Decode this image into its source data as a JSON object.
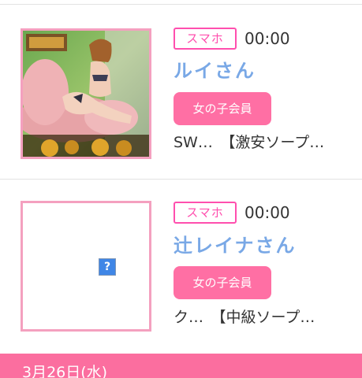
{
  "entries": [
    {
      "device": "スマホ",
      "time": "00:00",
      "name": "ルイさん",
      "badge": "女の子会員",
      "shop": "SW…　【激安ソープ…"
    },
    {
      "device": "スマホ",
      "time": "00:00",
      "name": "辻レイナさん",
      "badge": "女の子会員",
      "shop": "ク…　【中級ソープ…",
      "image_placeholder": "?"
    }
  ],
  "date_header": "3月26日(水)",
  "colors": {
    "pink_border": "#f4a0bf",
    "magenta": "#ff4fae",
    "badge_pink": "#ff6fa4",
    "name_blue": "#79a8e6",
    "date_bar": "#fb6e9f"
  }
}
